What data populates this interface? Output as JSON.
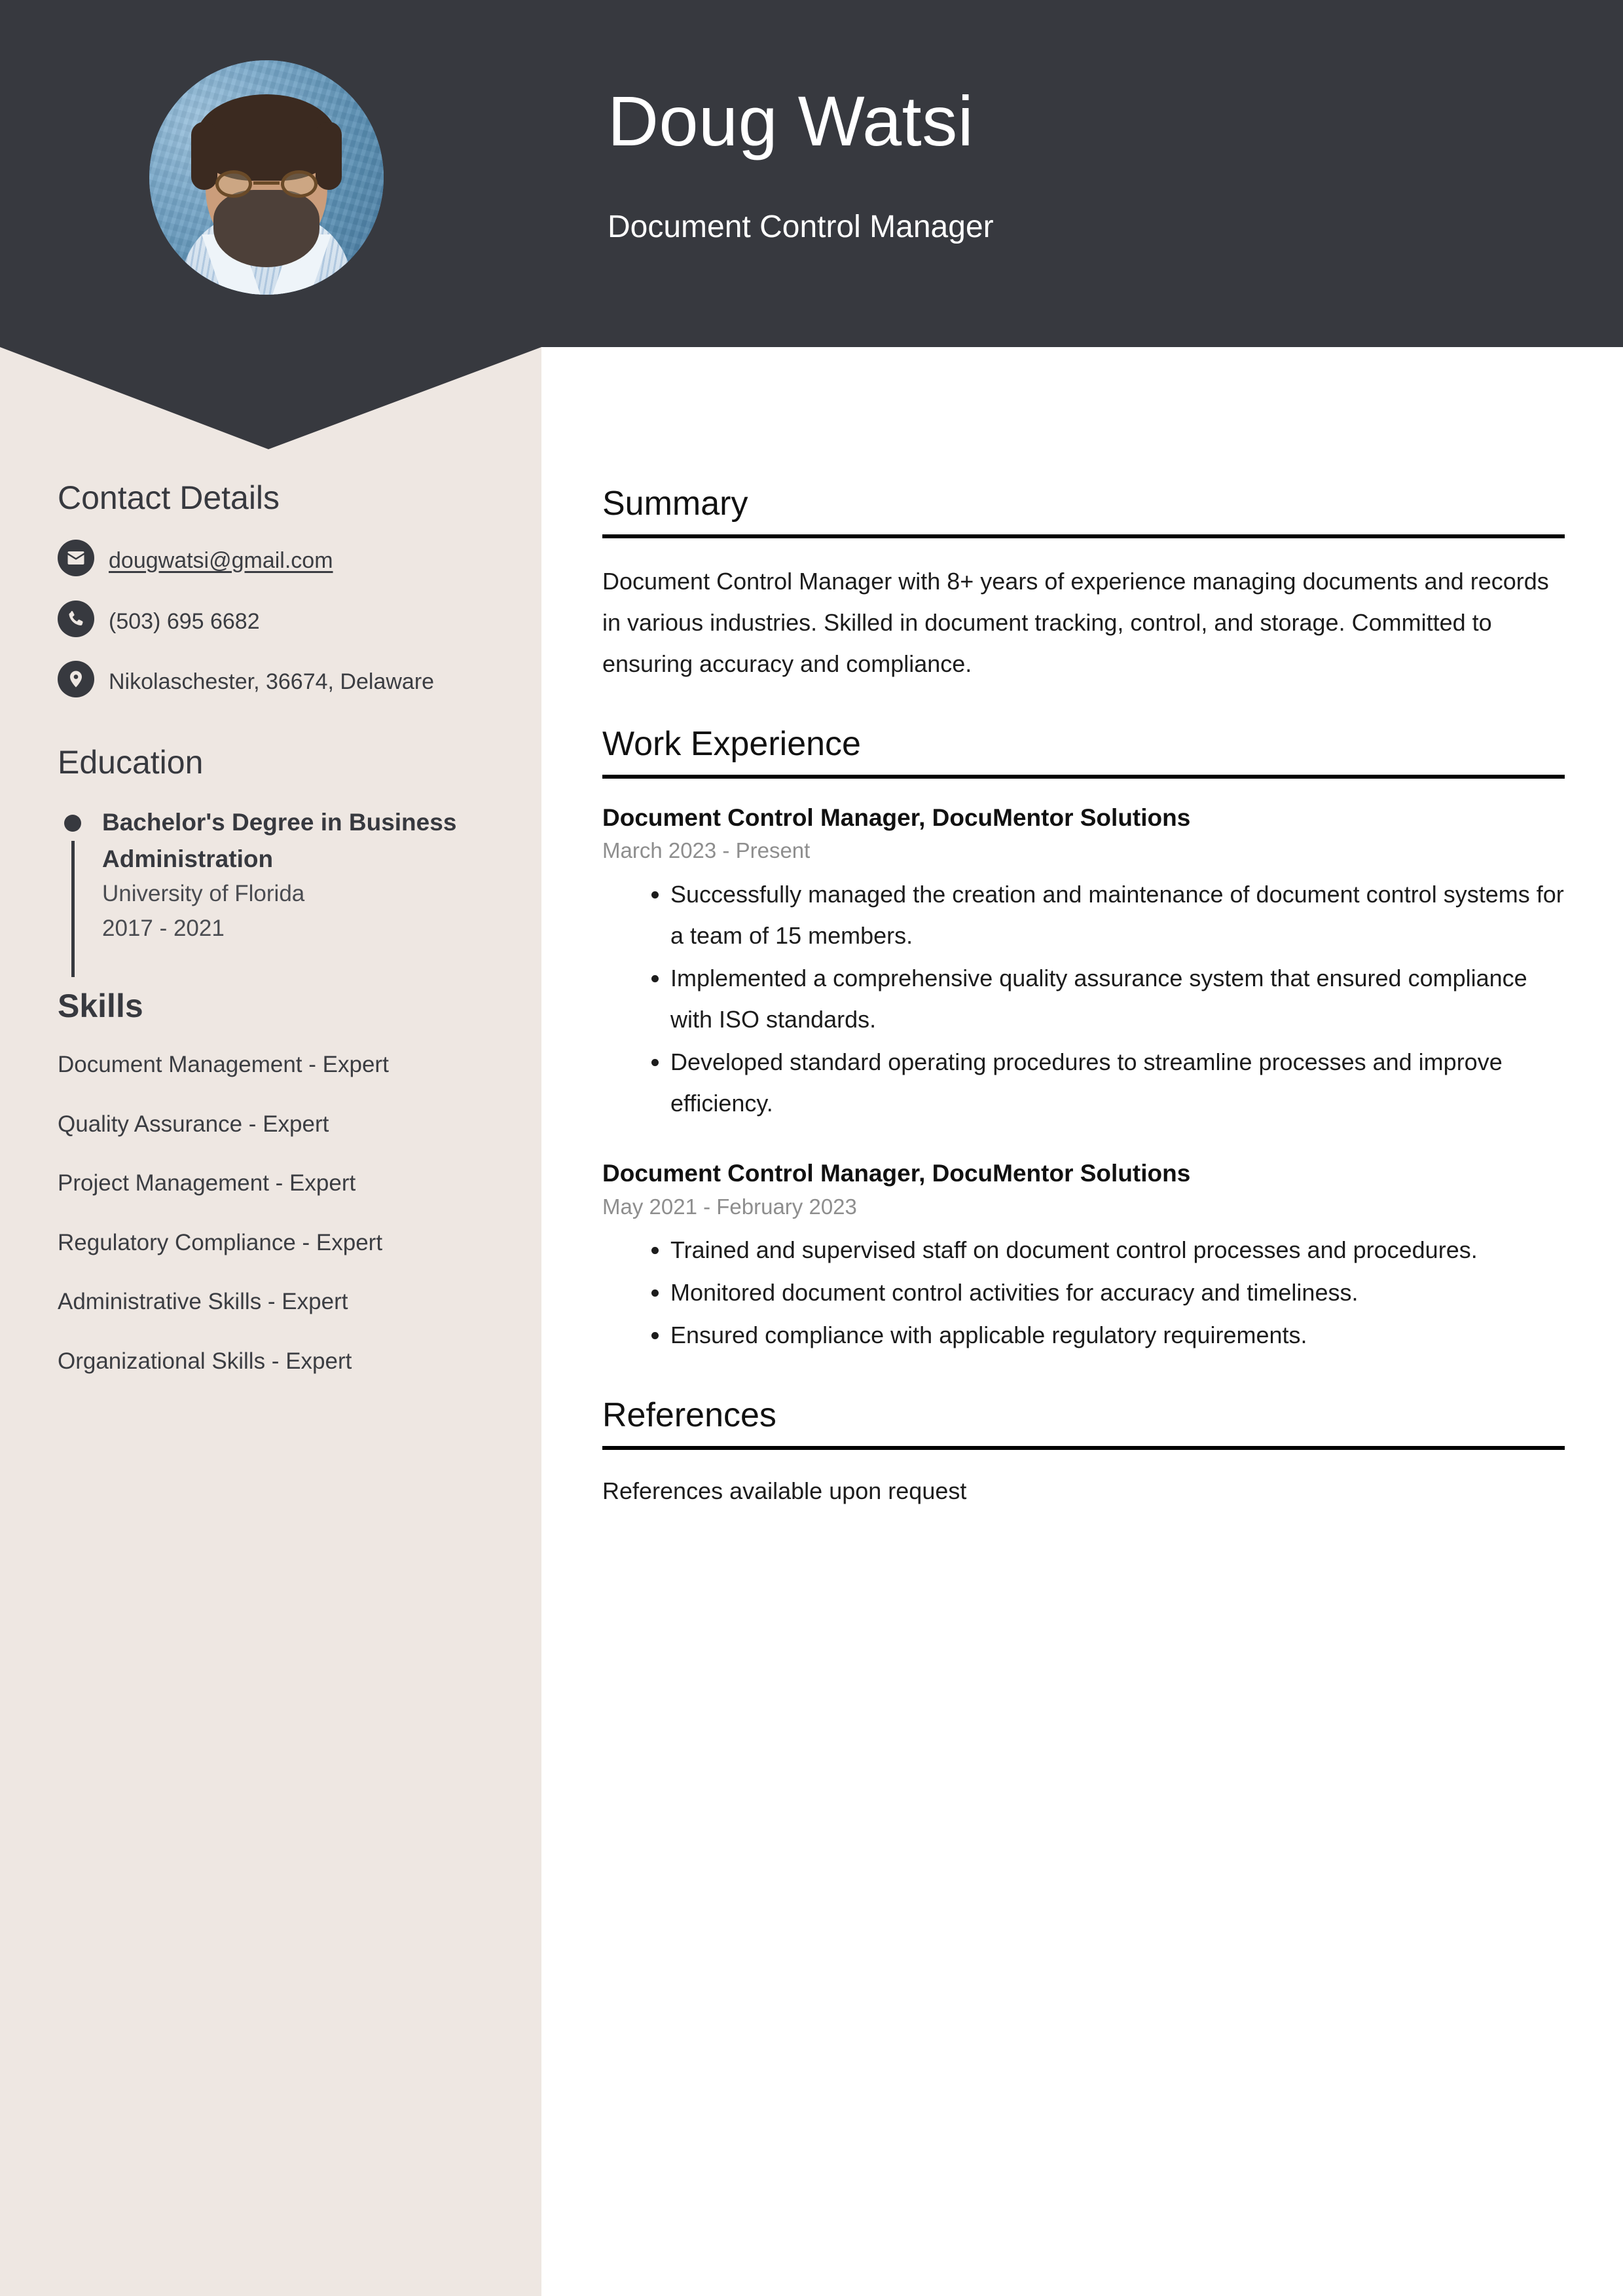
{
  "colors": {
    "dark": "#37393F",
    "sidebar_bg": "#EEE7E2",
    "page_bg": "#FFFFFF",
    "muted_text": "#8E8E8E",
    "body_text": "#1C1C1C"
  },
  "header": {
    "name": "Doug Watsi",
    "job_title": "Document Control Manager",
    "avatar_alt": "profile-photo"
  },
  "sidebar": {
    "contact": {
      "heading": "Contact Details",
      "items": [
        {
          "icon": "envelope-icon",
          "value": "dougwatsi@gmail.com",
          "is_link": true
        },
        {
          "icon": "phone-icon",
          "value": "(503) 695 6682",
          "is_link": false
        },
        {
          "icon": "location-pin-icon",
          "value": "Nikolaschester, 36674, Delaware",
          "is_link": false
        }
      ]
    },
    "education": {
      "heading": "Education",
      "items": [
        {
          "degree": "Bachelor's Degree in Business Administration",
          "school": "University of Florida",
          "dates": "2017 - 2021"
        }
      ]
    },
    "skills": {
      "heading": "Skills",
      "items": [
        "Document Management - Expert",
        "Quality Assurance - Expert",
        "Project Management - Expert",
        "Regulatory Compliance - Expert",
        "Administrative Skills - Expert",
        "Organizational Skills - Expert"
      ]
    }
  },
  "main": {
    "summary": {
      "heading": "Summary",
      "text": "Document Control Manager with 8+ years of experience managing documents and records in various industries. Skilled in document tracking, control, and storage. Committed to ensuring accuracy and compliance."
    },
    "work_experience": {
      "heading": "Work Experience",
      "jobs": [
        {
          "role": "Document Control Manager, DocuMentor Solutions",
          "dates": "March 2023 - Present",
          "bullets": [
            "Successfully managed the creation and maintenance of document control systems for a team of 15 members.",
            "Implemented a comprehensive quality assurance system that ensured compliance with ISO standards.",
            "Developed standard operating procedures to streamline processes and improve efficiency."
          ]
        },
        {
          "role": "Document Control Manager, DocuMentor Solutions",
          "dates": "May 2021 - February 2023",
          "bullets": [
            "Trained and supervised staff on document control processes and procedures.",
            "Monitored document control activities for accuracy and timeliness.",
            "Ensured compliance with applicable regulatory requirements."
          ]
        }
      ]
    },
    "references": {
      "heading": "References",
      "text": "References available upon request"
    }
  }
}
